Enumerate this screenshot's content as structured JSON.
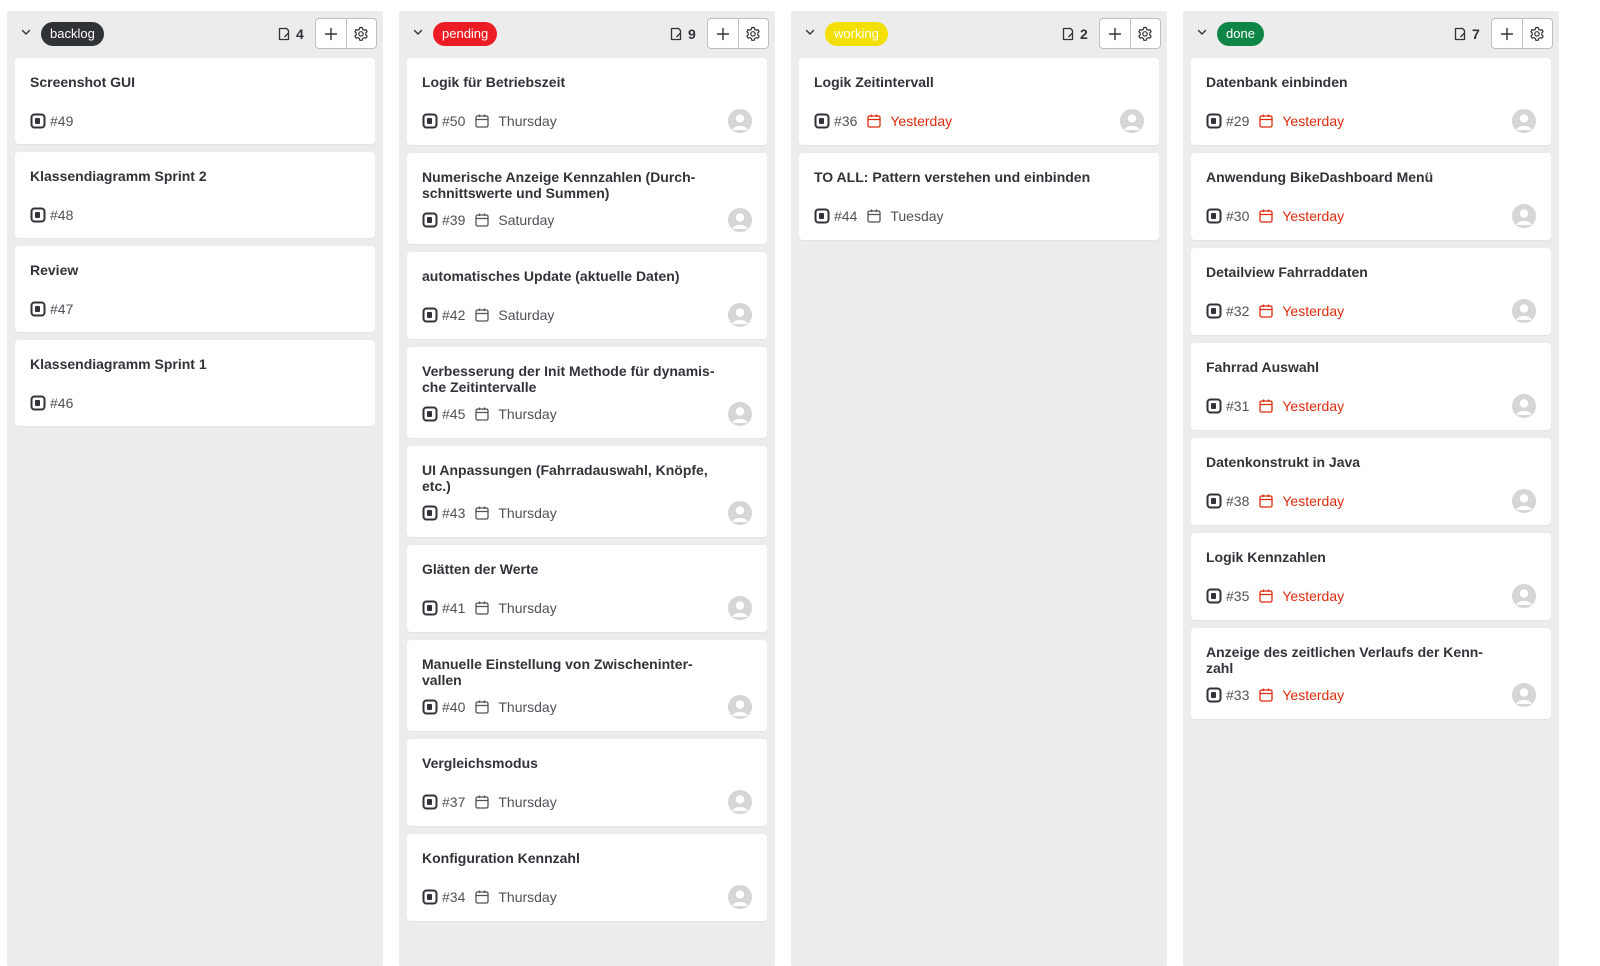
{
  "colors": {
    "column_bg": "#ececec",
    "card_bg": "#ffffff",
    "overdue": "#dd2b0e",
    "backlog": "#2f3337",
    "pending": "#ec1c24",
    "working": "#f3e000",
    "done": "#108548"
  },
  "icons": {
    "collapse": "chevron-down-icon",
    "issues": "issues-icon",
    "add": "plus-icon",
    "settings": "gear-icon",
    "issue_type": "issue-type-icon",
    "due_date": "calendar-icon",
    "assignee": "avatar-placeholder"
  },
  "columns": [
    {
      "label": "backlog",
      "count": "4",
      "cards": [
        {
          "title": "Screenshot GUI",
          "iid": "#49"
        },
        {
          "title": "Klassendiagramm Sprint 2",
          "iid": "#48"
        },
        {
          "title": "Review",
          "iid": "#47"
        },
        {
          "title": "Klassendiagramm Sprint 1",
          "iid": "#46"
        }
      ]
    },
    {
      "label": "pending",
      "count": "9",
      "cards": [
        {
          "title": "Logik für Betriebszeit",
          "iid": "#50",
          "due": "Thursday"
        },
        {
          "title": "Numerische Anzeige Kennzahlen (Durch-schnittswerte und Summen)",
          "iid": "#39",
          "due": "Saturday"
        },
        {
          "title": "automatisches Update (aktuelle Daten)",
          "iid": "#42",
          "due": "Saturday"
        },
        {
          "title": "Verbesserung der Init Methode für dynamis-che Zeitintervalle",
          "iid": "#45",
          "due": "Thursday"
        },
        {
          "title": "UI Anpassungen (Fahrradauswahl, Knöpfe, etc.)",
          "iid": "#43",
          "due": "Thursday"
        },
        {
          "title": "Glätten der Werte",
          "iid": "#41",
          "due": "Thursday"
        },
        {
          "title": "Manuelle Einstellung von Zwischeninter-vallen",
          "iid": "#40",
          "due": "Thursday"
        },
        {
          "title": "Vergleichsmodus",
          "iid": "#37",
          "due": "Thursday"
        },
        {
          "title": "Konfiguration Kennzahl",
          "iid": "#34",
          "due": "Thursday"
        }
      ]
    },
    {
      "label": "working",
      "count": "2",
      "cards": [
        {
          "title": "Logik Zeitintervall",
          "iid": "#36",
          "due": "Yesterday"
        },
        {
          "title": "TO ALL: Pattern verstehen und einbinden",
          "iid": "#44",
          "due": "Tuesday"
        }
      ]
    },
    {
      "label": "done",
      "count": "7",
      "cards": [
        {
          "title": "Datenbank einbinden",
          "iid": "#29",
          "due": "Yesterday"
        },
        {
          "title": "Anwendung BikeDashboard Menü",
          "iid": "#30",
          "due": "Yesterday"
        },
        {
          "title": "Detailview Fahrraddaten",
          "iid": "#32",
          "due": "Yesterday"
        },
        {
          "title": "Fahrrad Auswahl",
          "iid": "#31",
          "due": "Yesterday"
        },
        {
          "title": "Datenkonstrukt in Java",
          "iid": "#38",
          "due": "Yesterday"
        },
        {
          "title": "Logik Kennzahlen",
          "iid": "#35",
          "due": "Yesterday"
        },
        {
          "title": "Anzeige des zeitlichen Verlaufs der Kenn-zahl",
          "iid": "#33",
          "due": "Yesterday"
        }
      ]
    }
  ]
}
